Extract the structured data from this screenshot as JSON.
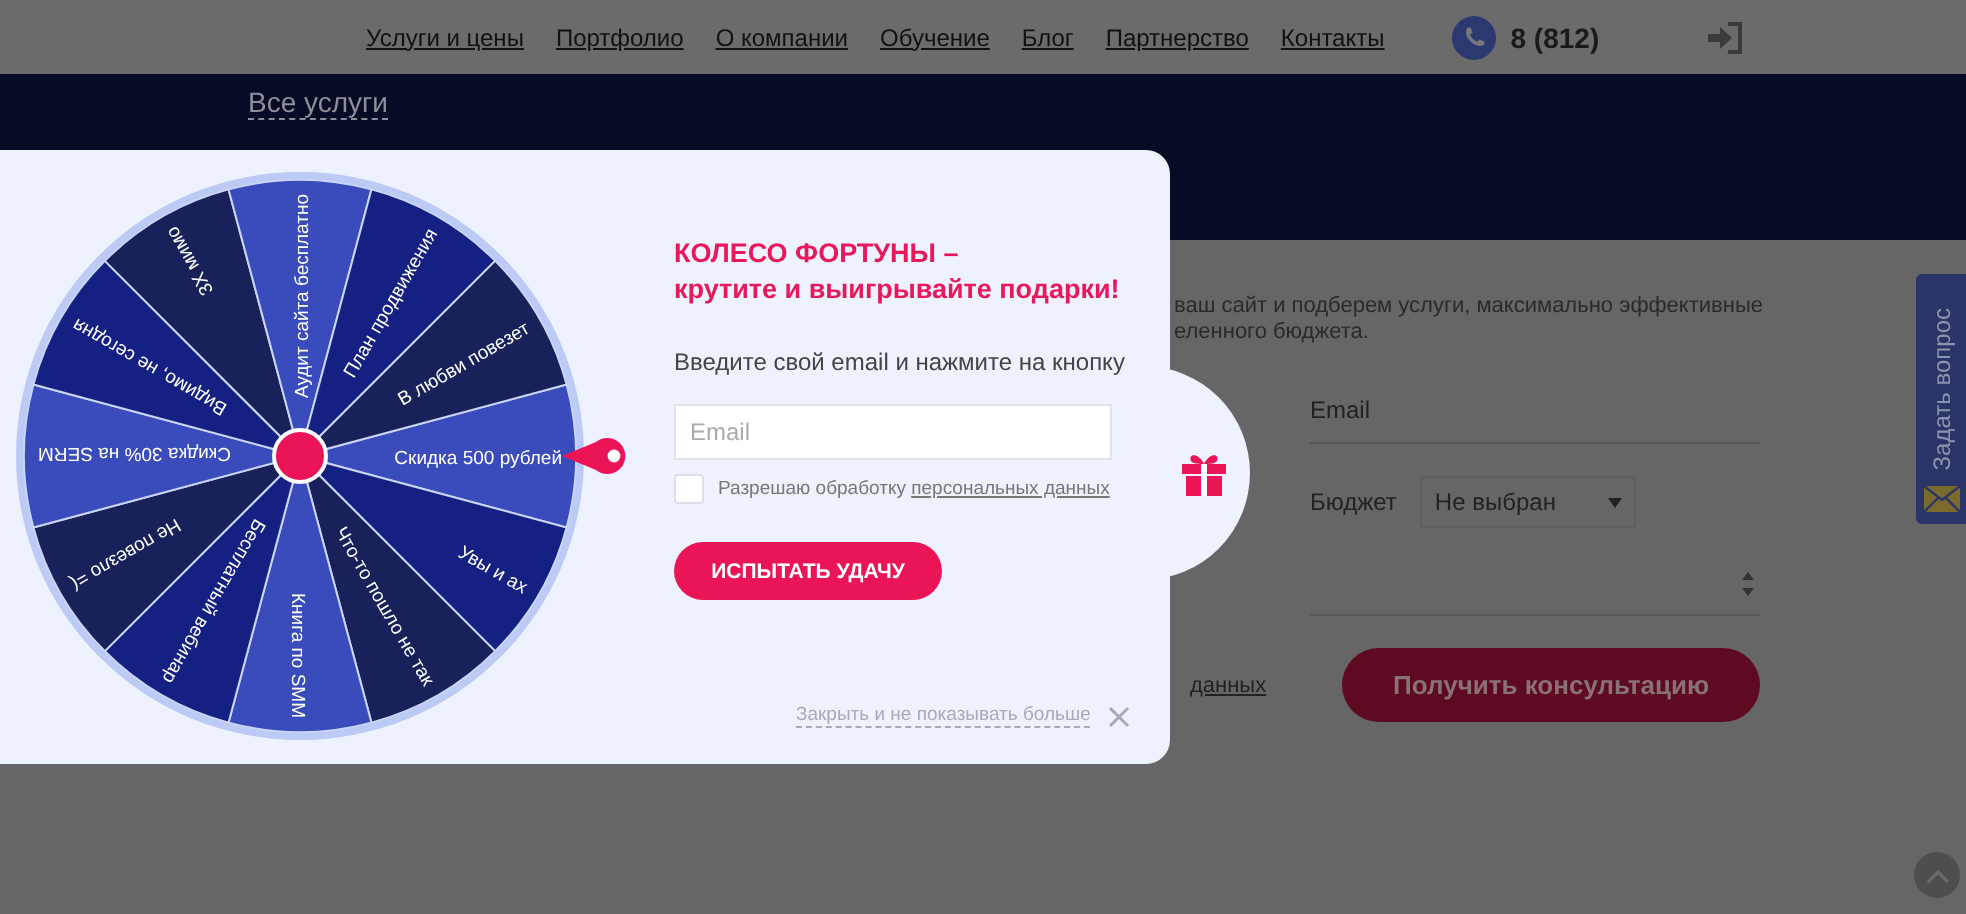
{
  "header": {
    "nav": [
      "Услуги и цены",
      "Портфолио",
      "О компании",
      "Обучение",
      "Блог",
      "Партнерство",
      "Контакты"
    ],
    "phone": "8 (812)"
  },
  "hero": {
    "breadcrumb": "Все услуги"
  },
  "form": {
    "intro": [
      "ваш сайт и подберем услуги, максимально эффективные",
      "еленного бюджета."
    ],
    "email_label": "Email",
    "budget_label": "Бюджет",
    "budget_value": "Не выбран",
    "consent_link": "данных",
    "submit": "Получить консультацию"
  },
  "side_tab": {
    "label": "Задать вопрос"
  },
  "popup": {
    "wheel": {
      "segments": [
        {
          "label": "Скидка 500 рублей",
          "color": "#3a4cbb"
        },
        {
          "label": "Увы и ах",
          "color": "#142182"
        },
        {
          "label": "Что-то пошло не так",
          "color": "#18215a"
        },
        {
          "label": "Книга по SMM",
          "color": "#3a4cbb"
        },
        {
          "label": "Бесплатный вебинар",
          "color": "#142182"
        },
        {
          "label": "Не повезло =(",
          "color": "#18215a"
        },
        {
          "label": "Скидка 30% на SERM",
          "color": "#3a4cbb"
        },
        {
          "label": "Видимо, не сегодня",
          "color": "#142182"
        },
        {
          "label": "3Х мимо",
          "color": "#18215a"
        },
        {
          "label": "Аудит сайта бесплатно",
          "color": "#3a4cbb"
        },
        {
          "label": "План продвижения",
          "color": "#142182"
        },
        {
          "label": "В любви повезет",
          "color": "#18215a"
        }
      ]
    },
    "title": [
      "КОЛЕСО ФОРТУНЫ –",
      "крутите и выигрывайте подарки!"
    ],
    "prompt": "Введите свой email и нажмите на кнопку",
    "email": {
      "placeholder": "Email"
    },
    "consent": {
      "checked": false,
      "text": "Разрешаю обработку",
      "link": "персональных данных"
    },
    "button": "ИСПЫТАТЬ УДАЧУ",
    "close_link": "Закрыть и не показывать больше"
  }
}
